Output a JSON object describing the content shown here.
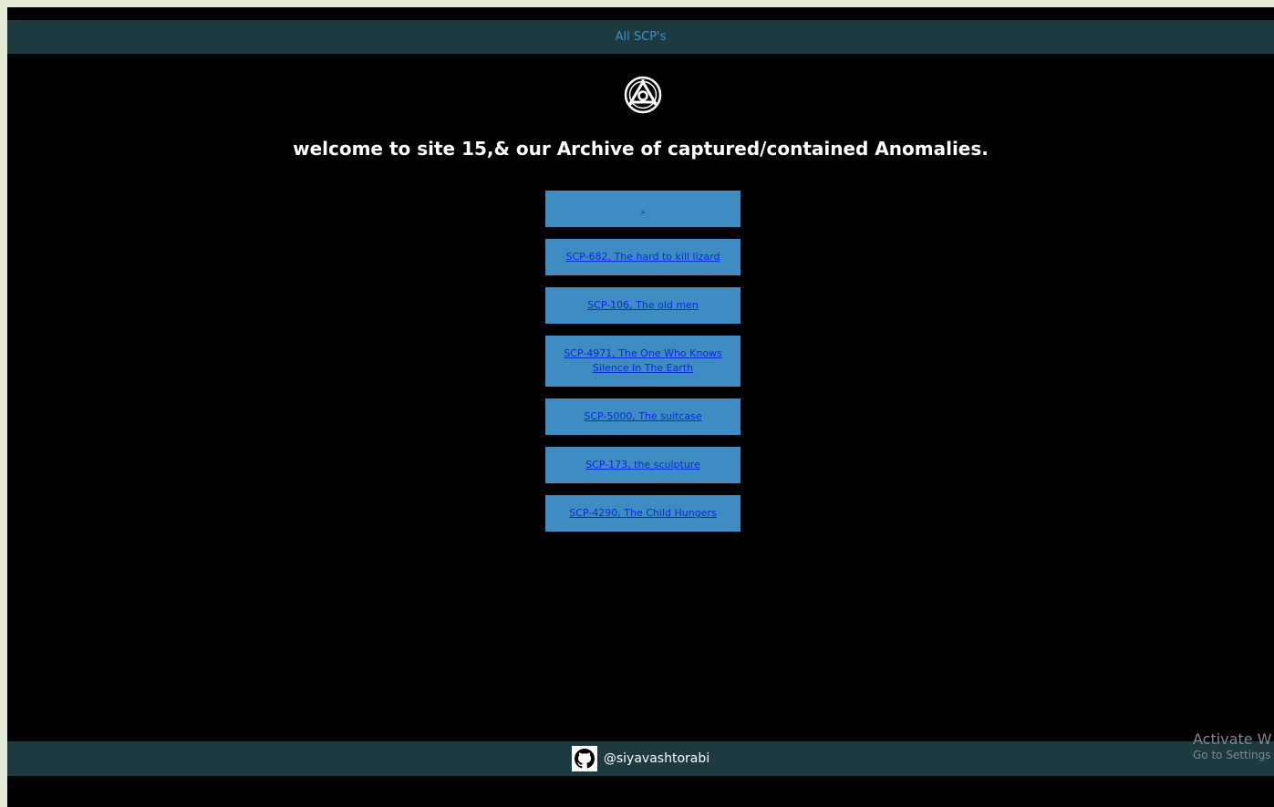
{
  "nav": {
    "link_label": "All SCP's"
  },
  "logo": {
    "icon": "scp-foundation-logo-icon"
  },
  "headline": "welcome to site 15,& our Archive of captured/contained Anomalies.",
  "scp_list": [
    {
      "label": "."
    },
    {
      "label": "SCP-682, The hard to kill lizard"
    },
    {
      "label": "SCP-106, The old men"
    },
    {
      "label": "SCP-4971, The One Who Knows Silence In The Earth"
    },
    {
      "label": "SCP-5000, The suitcase"
    },
    {
      "label": "SCP-173, the sculpture"
    },
    {
      "label": "SCP-4290, The Child Hungers"
    }
  ],
  "footer": {
    "icon": "github-icon",
    "handle": "@siyavashtorabi"
  },
  "watermark": {
    "line1": "Activate W",
    "line2": "Go to Settings"
  },
  "colors": {
    "page_bg": "#000000",
    "bar_bg": "#1c3a3f",
    "link_color": "#3f8fd2",
    "card_bg": "#3f8cc2",
    "card_link": "#0a2ad6",
    "outer_bg": "#e4ead8"
  }
}
